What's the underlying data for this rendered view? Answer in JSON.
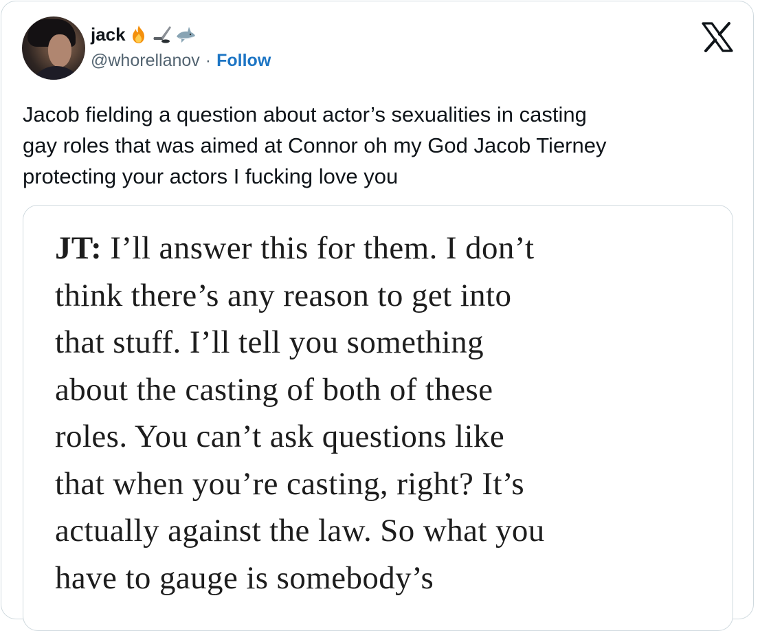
{
  "author": {
    "display_name": "jack",
    "name_emojis": [
      "fire-emoji",
      "hockey-emoji",
      "shark-emoji"
    ],
    "handle": "@whorellanov",
    "separator": "·",
    "follow_label": "Follow"
  },
  "brand_icon": "x-logo-icon",
  "tweet": {
    "lines": [
      "Jacob fielding a question about actor’s sexualities in casting",
      "gay roles that was aimed at Connor oh my God Jacob Tierney",
      "protecting your actors I fucking love you"
    ]
  },
  "image": {
    "speaker": "JT:",
    "first_line_rest": " I’ll answer this for them. I don’t",
    "lines": [
      "think there’s any reason to get into",
      "that stuff. I’ll tell you something",
      "about the casting of both of these",
      "roles. You can’t ask questions like",
      "that when you’re casting, right? It’s",
      "actually against the law. So what you",
      "have to gauge is somebody’s"
    ]
  },
  "colors": {
    "text": "#0f1419",
    "secondary": "#536471",
    "link": "#1d75c4",
    "border": "#cfd9de"
  }
}
